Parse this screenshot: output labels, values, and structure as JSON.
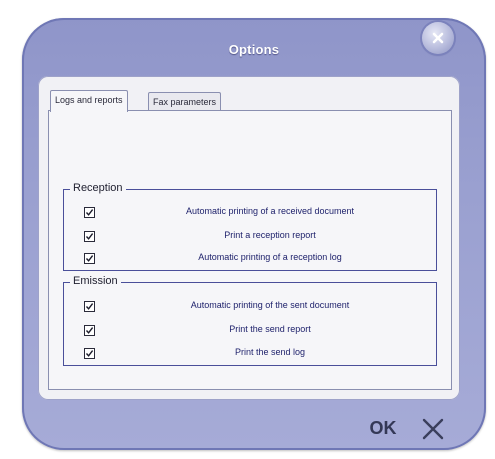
{
  "window": {
    "title": "Options"
  },
  "tabs": [
    {
      "label": "Logs and reports",
      "active": true
    },
    {
      "label": "Fax parameters",
      "active": false
    }
  ],
  "reception": {
    "legend": "Reception",
    "items": [
      {
        "label": "Automatic printing of a received document",
        "checked": true
      },
      {
        "label": "Print a reception report",
        "checked": true
      },
      {
        "label": "Automatic printing of a reception log",
        "checked": true
      }
    ]
  },
  "emission": {
    "legend": "Emission",
    "items": [
      {
        "label": "Automatic printing of the sent document",
        "checked": true
      },
      {
        "label": "Print the send report",
        "checked": true
      },
      {
        "label": "Print the send log",
        "checked": true
      }
    ]
  },
  "buttons": {
    "ok_label": "OK",
    "cancel_icon": "x-icon",
    "close_icon": "close-icon"
  },
  "colors": {
    "frame": "#9aa0d0",
    "label_text": "#1c1f6a",
    "group_border": "#4a4f9a"
  }
}
